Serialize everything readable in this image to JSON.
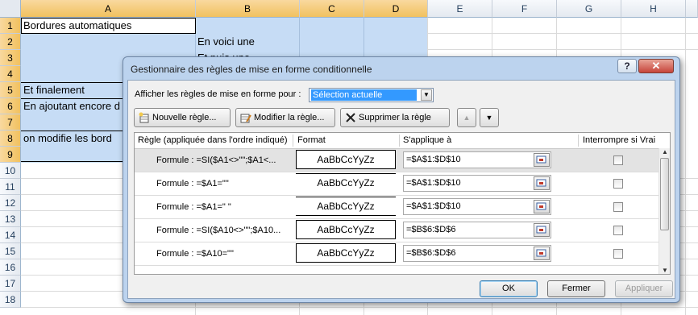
{
  "sheet": {
    "columns": [
      "A",
      "B",
      "C",
      "D",
      "E",
      "F",
      "G",
      "H"
    ],
    "rows": [
      "1",
      "2",
      "3",
      "4",
      "5",
      "6",
      "7",
      "8",
      "9",
      "10",
      "11",
      "12",
      "13",
      "14",
      "15",
      "16",
      "17",
      "18"
    ],
    "cells": {
      "a1": "Bordures automatiques",
      "b2": "En voici une",
      "b3": "Et puis une",
      "a5": "Et finalement",
      "a6": "En ajoutant encore d",
      "a8": "on modifie les bord"
    }
  },
  "dialog": {
    "title": "Gestionnaire des règles de mise en forme conditionnelle",
    "help_label": "?",
    "close_label": "✕",
    "show_rules_label": "Afficher les règles de mise en forme pour :",
    "show_rules_value": "Sélection actuelle",
    "toolbar": {
      "new_rule": "Nouvelle règle...",
      "edit_rule": "Modifier la règle...",
      "delete_rule": "Supprimer la règle"
    },
    "grid": {
      "headers": {
        "rule": "Règle (appliquée dans l'ordre indiqué)",
        "format": "Format",
        "applies_to": "S'applique à",
        "stop_if_true": "Interrompre si Vrai"
      },
      "rows": [
        {
          "rule": "Formule : =SI($A1<>\"\";$A1<...",
          "format": "AaBbCcYyZz",
          "range": "=$A$1:$D$10"
        },
        {
          "rule": "Formule : =$A1=\"\"",
          "format": "AaBbCcYyZz",
          "range": "=$A$1:$D$10"
        },
        {
          "rule": "Formule : =$A1=\" \"",
          "format": "AaBbCcYyZz",
          "range": "=$A$1:$D$10"
        },
        {
          "rule": "Formule : =SI($A10<>\"\";$A10...",
          "format": "AaBbCcYyZz",
          "range": "=$B$6:$D$6"
        },
        {
          "rule": "Formule : =$A10=\"\"",
          "format": "AaBbCcYyZz",
          "range": "=$B$6:$D$6"
        }
      ]
    },
    "buttons": {
      "ok": "OK",
      "close": "Fermer",
      "apply": "Appliquer"
    }
  }
}
